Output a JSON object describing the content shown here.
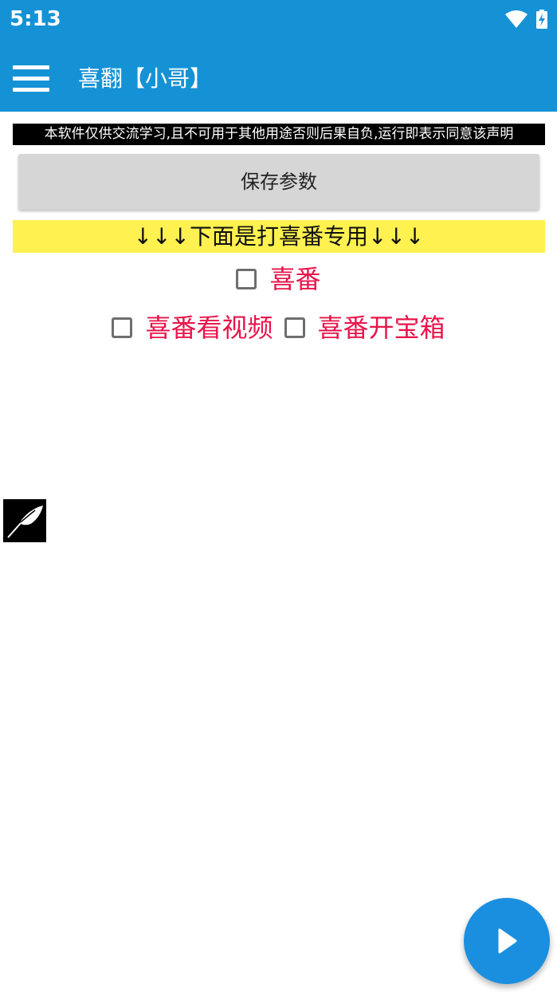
{
  "status_bar": {
    "time": "5:13",
    "icons": [
      "wifi-icon",
      "battery-charging-icon"
    ]
  },
  "app_bar": {
    "menu_icon": "menu-icon",
    "title": "喜翻【小哥】"
  },
  "disclaimer": "本软件仅供交流学习,且不可用于其他用途否则后果自负,运行即表示同意该声明",
  "save_button": {
    "label": "保存参数"
  },
  "section_banner": "↓↓↓下面是打喜番专用↓↓↓",
  "checkboxes": {
    "row1": [
      {
        "label": "喜番",
        "checked": false
      }
    ],
    "row2": [
      {
        "label": "喜番看视频",
        "checked": false
      },
      {
        "label": "喜番开宝箱",
        "checked": false
      }
    ]
  },
  "floating_icon": "quill-icon",
  "fab": {
    "icon": "play-icon"
  },
  "colors": {
    "primary": "#1592d6",
    "fab": "#1a8fe0",
    "banner": "#fff14f",
    "checkbox_label": "#e8144a",
    "button_bg": "#d6d6d6"
  }
}
